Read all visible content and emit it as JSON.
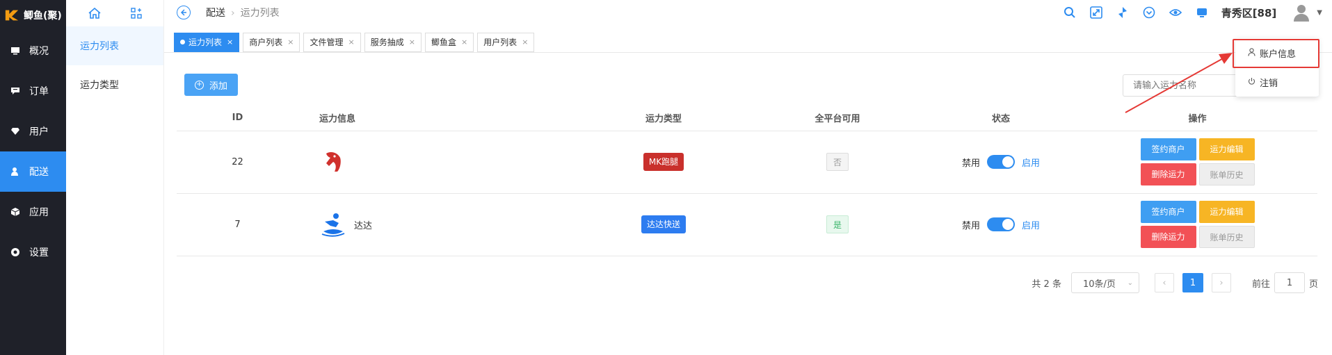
{
  "app": {
    "logo_text": "鲫鱼(聚)"
  },
  "nav": {
    "items": [
      {
        "label": "概况",
        "icon": "monitor-icon"
      },
      {
        "label": "订单",
        "icon": "order-icon"
      },
      {
        "label": "用户",
        "icon": "diamond-icon"
      },
      {
        "label": "配送",
        "icon": "user-delivery-icon"
      },
      {
        "label": "应用",
        "icon": "cube-icon"
      },
      {
        "label": "设置",
        "icon": "circle-icon"
      }
    ],
    "active_index": 3
  },
  "submenu": {
    "items": [
      {
        "label": "运力列表"
      },
      {
        "label": "运力类型"
      }
    ]
  },
  "header": {
    "breadcrumb_root": "配送",
    "breadcrumb_current": "运力列表",
    "region": "青秀区[88]"
  },
  "tabs": [
    {
      "label": "运力列表"
    },
    {
      "label": "商户列表"
    },
    {
      "label": "文件管理"
    },
    {
      "label": "服务抽成"
    },
    {
      "label": "鲫鱼盒"
    },
    {
      "label": "用户列表"
    }
  ],
  "toolbar": {
    "add_label": "添加",
    "search_placeholder": "请输入运力名称"
  },
  "table": {
    "columns": [
      "ID",
      "运力信息",
      "运力类型",
      "全平台可用",
      "状态",
      "操作"
    ],
    "rows": [
      {
        "id": "22",
        "name": "",
        "type": "MK跑腿",
        "type_color": "#c9302c",
        "all_platform": "否",
        "off_label": "禁用",
        "on_label": "启用"
      },
      {
        "id": "7",
        "name": "达达",
        "type": "达达快送",
        "type_color": "#2d7cf0",
        "all_platform": "是",
        "off_label": "禁用",
        "on_label": "启用"
      }
    ],
    "ops": {
      "sign": "签约商户",
      "edit": "运力编辑",
      "delete": "删除运力",
      "history": "账单历史"
    }
  },
  "pagination": {
    "total": "共 2 条",
    "page_size": "10条/页",
    "current_page": "1",
    "goto_label": "前往",
    "goto_value": "1",
    "page_unit": "页"
  },
  "account_menu": {
    "items": [
      {
        "label": "账户信息"
      },
      {
        "label": "注销"
      }
    ]
  },
  "colors": {
    "primary": "#2d8cf0",
    "nav_bg": "#1f2129",
    "annotation": "#e53935"
  }
}
